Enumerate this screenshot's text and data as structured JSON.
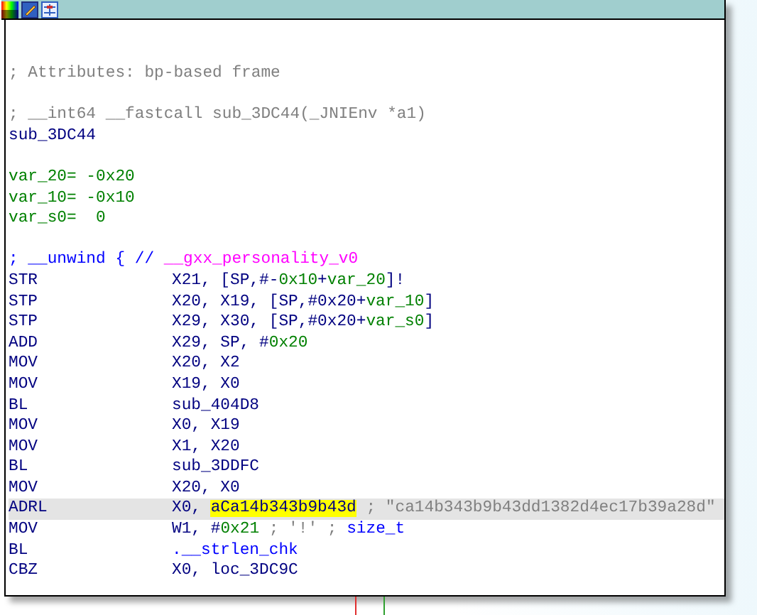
{
  "lines": [
    {
      "kind": "comment",
      "segments": [
        {
          "text": "; Attributes: bp-based frame",
          "kind": "comment"
        }
      ]
    },
    {
      "kind": "blank"
    },
    {
      "kind": "comment",
      "segments": [
        {
          "text": "; __int64 __fastcall sub_3DC44(_JNIEnv *a1)",
          "kind": "comment"
        }
      ]
    },
    {
      "kind": "label",
      "segments": [
        {
          "text": "sub_3DC44",
          "kind": "plain"
        }
      ]
    },
    {
      "kind": "blank"
    },
    {
      "kind": "var",
      "segments": [
        {
          "text": "var_20= -0x20",
          "kind": "num"
        }
      ]
    },
    {
      "kind": "var",
      "segments": [
        {
          "text": "var_10= -0x10",
          "kind": "num"
        }
      ]
    },
    {
      "kind": "var",
      "segments": [
        {
          "text": "var_s0=  0",
          "kind": "num"
        }
      ]
    },
    {
      "kind": "blank"
    },
    {
      "kind": "comment",
      "segments": [
        {
          "text": "; __unwind { // ",
          "kind": "keyword"
        },
        {
          "text": "__gxx_personality_v0",
          "kind": "import"
        }
      ]
    },
    {
      "kind": "instr",
      "selected": false,
      "mnemonic": "STR",
      "segments": [
        {
          "text": "X21, [SP,#-",
          "kind": "plain"
        },
        {
          "text": "0x10",
          "kind": "num"
        },
        {
          "text": "+",
          "kind": "plain"
        },
        {
          "text": "var_20",
          "kind": "num"
        },
        {
          "text": "]!",
          "kind": "plain"
        }
      ]
    },
    {
      "kind": "instr",
      "selected": false,
      "mnemonic": "STP",
      "segments": [
        {
          "text": "X20, X19, [SP,#0x20+",
          "kind": "plain"
        },
        {
          "text": "var_10",
          "kind": "num"
        },
        {
          "text": "]",
          "kind": "plain"
        }
      ]
    },
    {
      "kind": "instr",
      "selected": false,
      "mnemonic": "STP",
      "segments": [
        {
          "text": "X29, X30, [SP,#0x20+",
          "kind": "plain"
        },
        {
          "text": "var_s0",
          "kind": "num"
        },
        {
          "text": "]",
          "kind": "plain"
        }
      ]
    },
    {
      "kind": "instr",
      "selected": false,
      "mnemonic": "ADD",
      "segments": [
        {
          "text": "X29, SP, #",
          "kind": "plain"
        },
        {
          "text": "0x20",
          "kind": "num"
        }
      ]
    },
    {
      "kind": "instr",
      "selected": false,
      "mnemonic": "MOV",
      "segments": [
        {
          "text": "X20, X2",
          "kind": "plain"
        }
      ]
    },
    {
      "kind": "instr",
      "selected": false,
      "mnemonic": "MOV",
      "segments": [
        {
          "text": "X19, X0",
          "kind": "plain"
        }
      ]
    },
    {
      "kind": "instr",
      "selected": false,
      "mnemonic": "BL",
      "segments": [
        {
          "text": "sub_404D8",
          "kind": "plain"
        }
      ]
    },
    {
      "kind": "instr",
      "selected": false,
      "mnemonic": "MOV",
      "segments": [
        {
          "text": "X0, X19",
          "kind": "plain"
        }
      ]
    },
    {
      "kind": "instr",
      "selected": false,
      "mnemonic": "MOV",
      "segments": [
        {
          "text": "X1, X20",
          "kind": "plain"
        }
      ]
    },
    {
      "kind": "instr",
      "selected": false,
      "mnemonic": "BL",
      "segments": [
        {
          "text": "sub_3DDFC",
          "kind": "plain"
        }
      ]
    },
    {
      "kind": "instr",
      "selected": false,
      "mnemonic": "MOV",
      "segments": [
        {
          "text": "X20, X0",
          "kind": "plain"
        }
      ]
    },
    {
      "kind": "instr",
      "selected": true,
      "mnemonic": "ADRL",
      "segments": [
        {
          "text": "X0, ",
          "kind": "plain"
        },
        {
          "text": "aCa14b343b9b43d",
          "kind": "highlight"
        },
        {
          "text": " ; \"ca14b343b9b43dd1382d4ec17b39a28d\"",
          "kind": "comment"
        }
      ]
    },
    {
      "kind": "instr",
      "selected": false,
      "mnemonic": "MOV",
      "segments": [
        {
          "text": "W1, #",
          "kind": "plain"
        },
        {
          "text": "0x21",
          "kind": "num"
        },
        {
          "text": " ; '!' ; ",
          "kind": "comment"
        },
        {
          "text": "size_t",
          "kind": "keyword"
        }
      ]
    },
    {
      "kind": "instr",
      "selected": false,
      "mnemonic": "BL",
      "segments": [
        {
          "text": ".__strlen_chk",
          "kind": "keyword"
        }
      ]
    },
    {
      "kind": "instr",
      "selected": false,
      "mnemonic": "CBZ",
      "segments": [
        {
          "text": "X0, loc_3DC9C",
          "kind": "plain"
        }
      ]
    }
  ]
}
